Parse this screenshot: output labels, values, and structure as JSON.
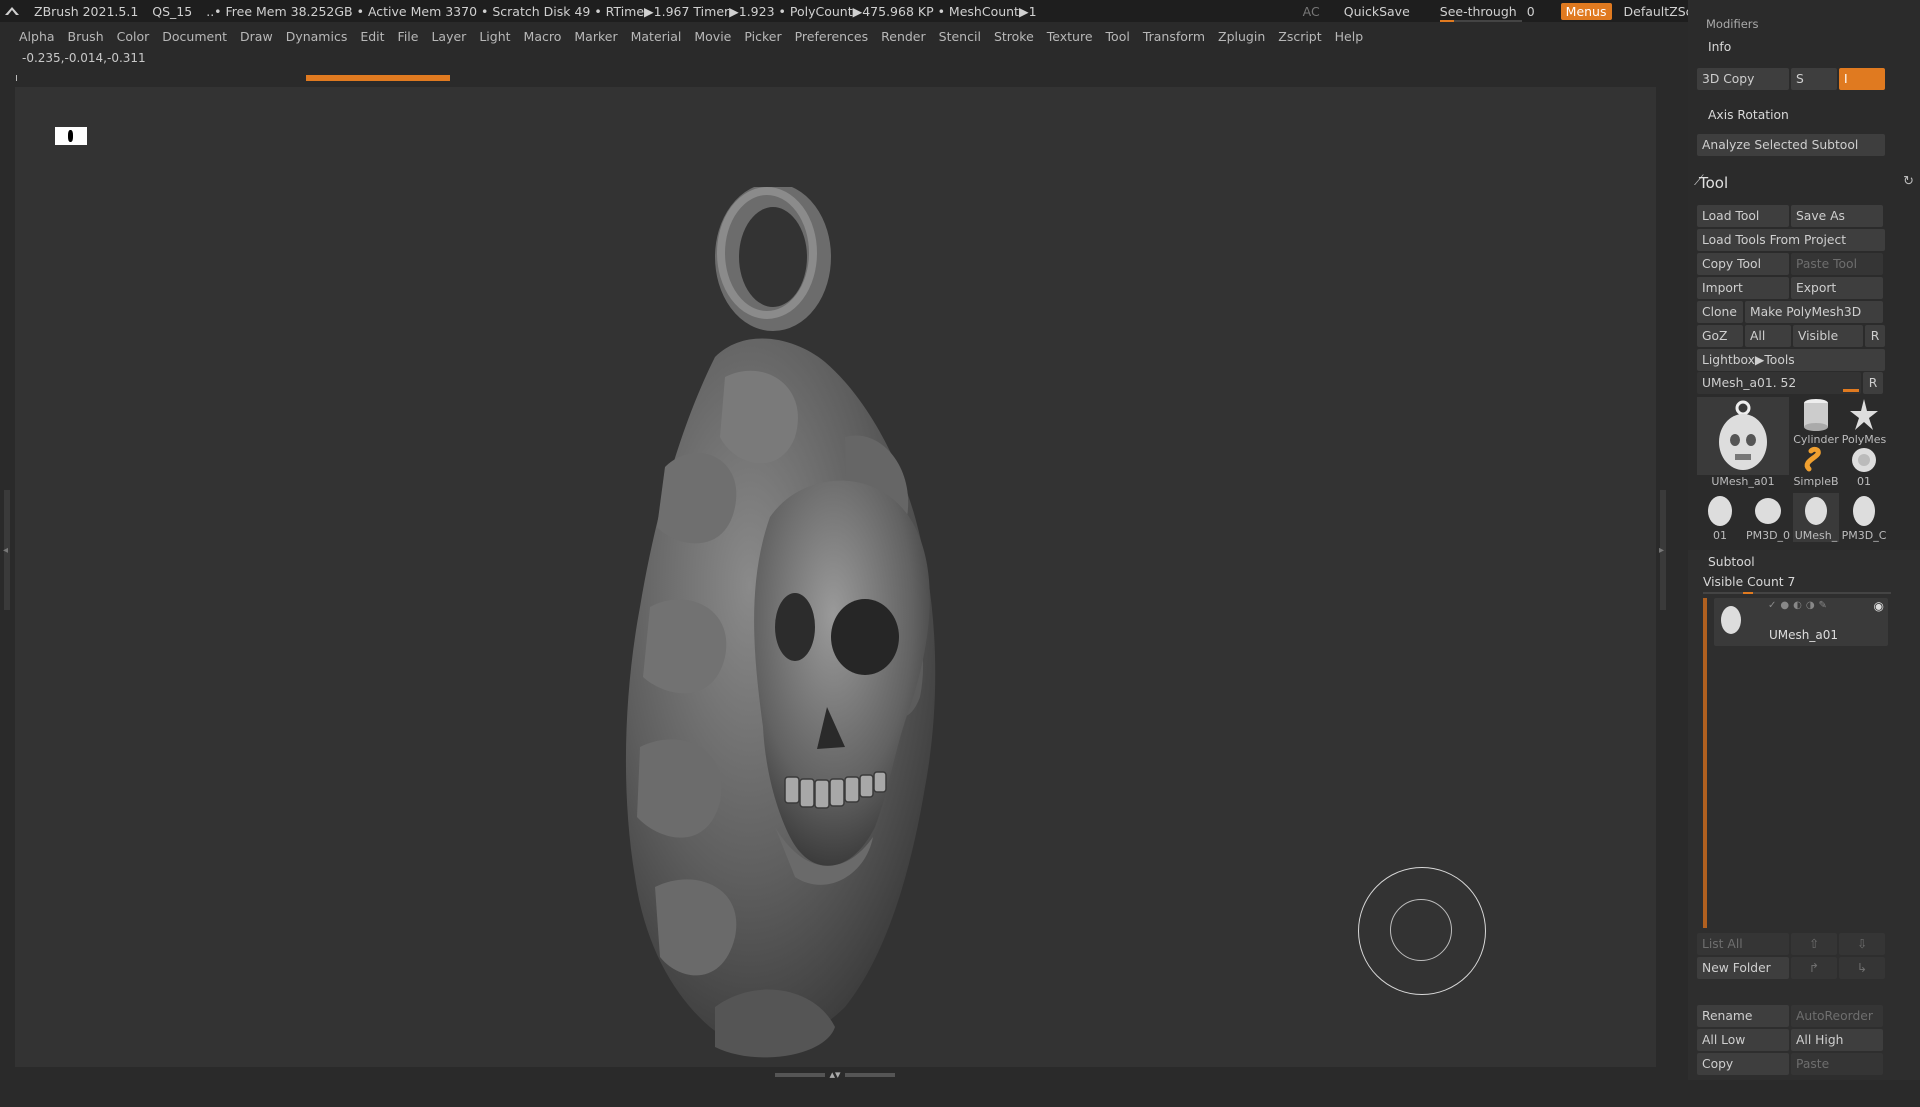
{
  "titlebar": {
    "app_version": "ZBrush 2021.5.1",
    "doc_name": "QS_15",
    "stats": "..• Free Mem 38.252GB • Active Mem 3370 • Scratch Disk 49 •  RTime▶1.967 Timer▶1.923 • PolyCount▶475.968 KP  • MeshCount▶1",
    "ac": "AC",
    "quicksave": "QuickSave",
    "see_through_label": "See-through",
    "see_through_value": "0",
    "see_through_level": 0.17,
    "menus": "Menus",
    "script": "DefaultZScript"
  },
  "menu_items": [
    "Alpha",
    "Brush",
    "Color",
    "Document",
    "Draw",
    "Dynamics",
    "Edit",
    "File",
    "Layer",
    "Light",
    "Macro",
    "Marker",
    "Material",
    "Movie",
    "Picker",
    "Preferences",
    "Render",
    "Stencil",
    "Stroke",
    "Texture",
    "Tool",
    "Transform",
    "Zplugin",
    "Zscript",
    "Help"
  ],
  "coords": "-0.235,-0.014,-0.311",
  "panel": {
    "modifiers_label": "Modifiers",
    "info_label": "Info",
    "copy3d_label": "3D Copy",
    "s_label": "S",
    "axis_rotation": "Axis Rotation",
    "analyze": "Analyze Selected Subtool",
    "tool_title": "Tool",
    "load_tool": "Load Tool",
    "save_as": "Save As",
    "load_from_project": "Load Tools From Project",
    "copy_tool": "Copy Tool",
    "paste_tool": "Paste Tool",
    "import": "Import",
    "export": "Export",
    "clone": "Clone",
    "make_polymesh": "Make PolyMesh3D",
    "goz": "GoZ",
    "all": "All",
    "visible": "Visible",
    "r": "R",
    "lightbox_tools": "Lightbox▶Tools",
    "current_tool": "UMesh_a01. 52",
    "thumbs": {
      "main": "UMesh_a01",
      "cylinder": "Cylinder",
      "polymesh": "PolyMes",
      "simpleb": "SimpleB",
      "t01": "01",
      "b01": "01",
      "pm3d": "PM3D_0",
      "umesh": "UMesh_",
      "pm3d2": "PM3D_C"
    },
    "subtool_label": "Subtool",
    "visible_count": "Visible Count 7",
    "subtool_name": "UMesh_a01",
    "list_all": "List All",
    "new_folder": "New Folder",
    "rename": "Rename",
    "autoreorder": "AutoReorder",
    "all_low": "All Low",
    "all_high": "All High",
    "copy": "Copy",
    "paste": "Paste"
  },
  "colors": {
    "accent": "#e07a20"
  }
}
